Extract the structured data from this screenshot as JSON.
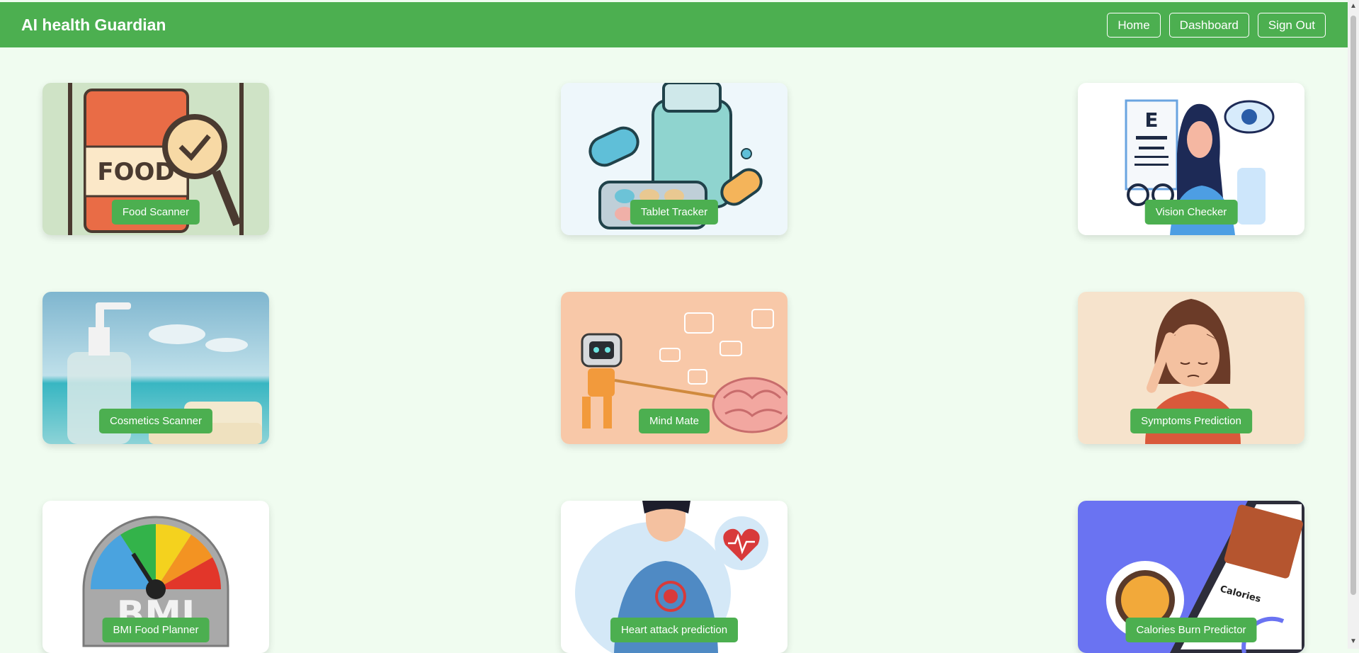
{
  "header": {
    "title": "AI health Guardian",
    "nav": [
      "Home",
      "Dashboard",
      "Sign Out"
    ]
  },
  "cards": [
    {
      "label": "Food Scanner",
      "image_text": "FOOD"
    },
    {
      "label": "Tablet Tracker"
    },
    {
      "label": "Vision Checker",
      "image_text": "E"
    },
    {
      "label": "Cosmetics Scanner"
    },
    {
      "label": "Mind Mate"
    },
    {
      "label": "Symptoms Prediction"
    },
    {
      "label": "BMI Food Planner",
      "image_text": "BMI"
    },
    {
      "label": "Heart attack prediction"
    },
    {
      "label": "Calories Burn Predictor",
      "image_text": "Calories"
    }
  ],
  "colors": {
    "accent": "#4caf50",
    "page_bg": "#f0fcf0"
  }
}
